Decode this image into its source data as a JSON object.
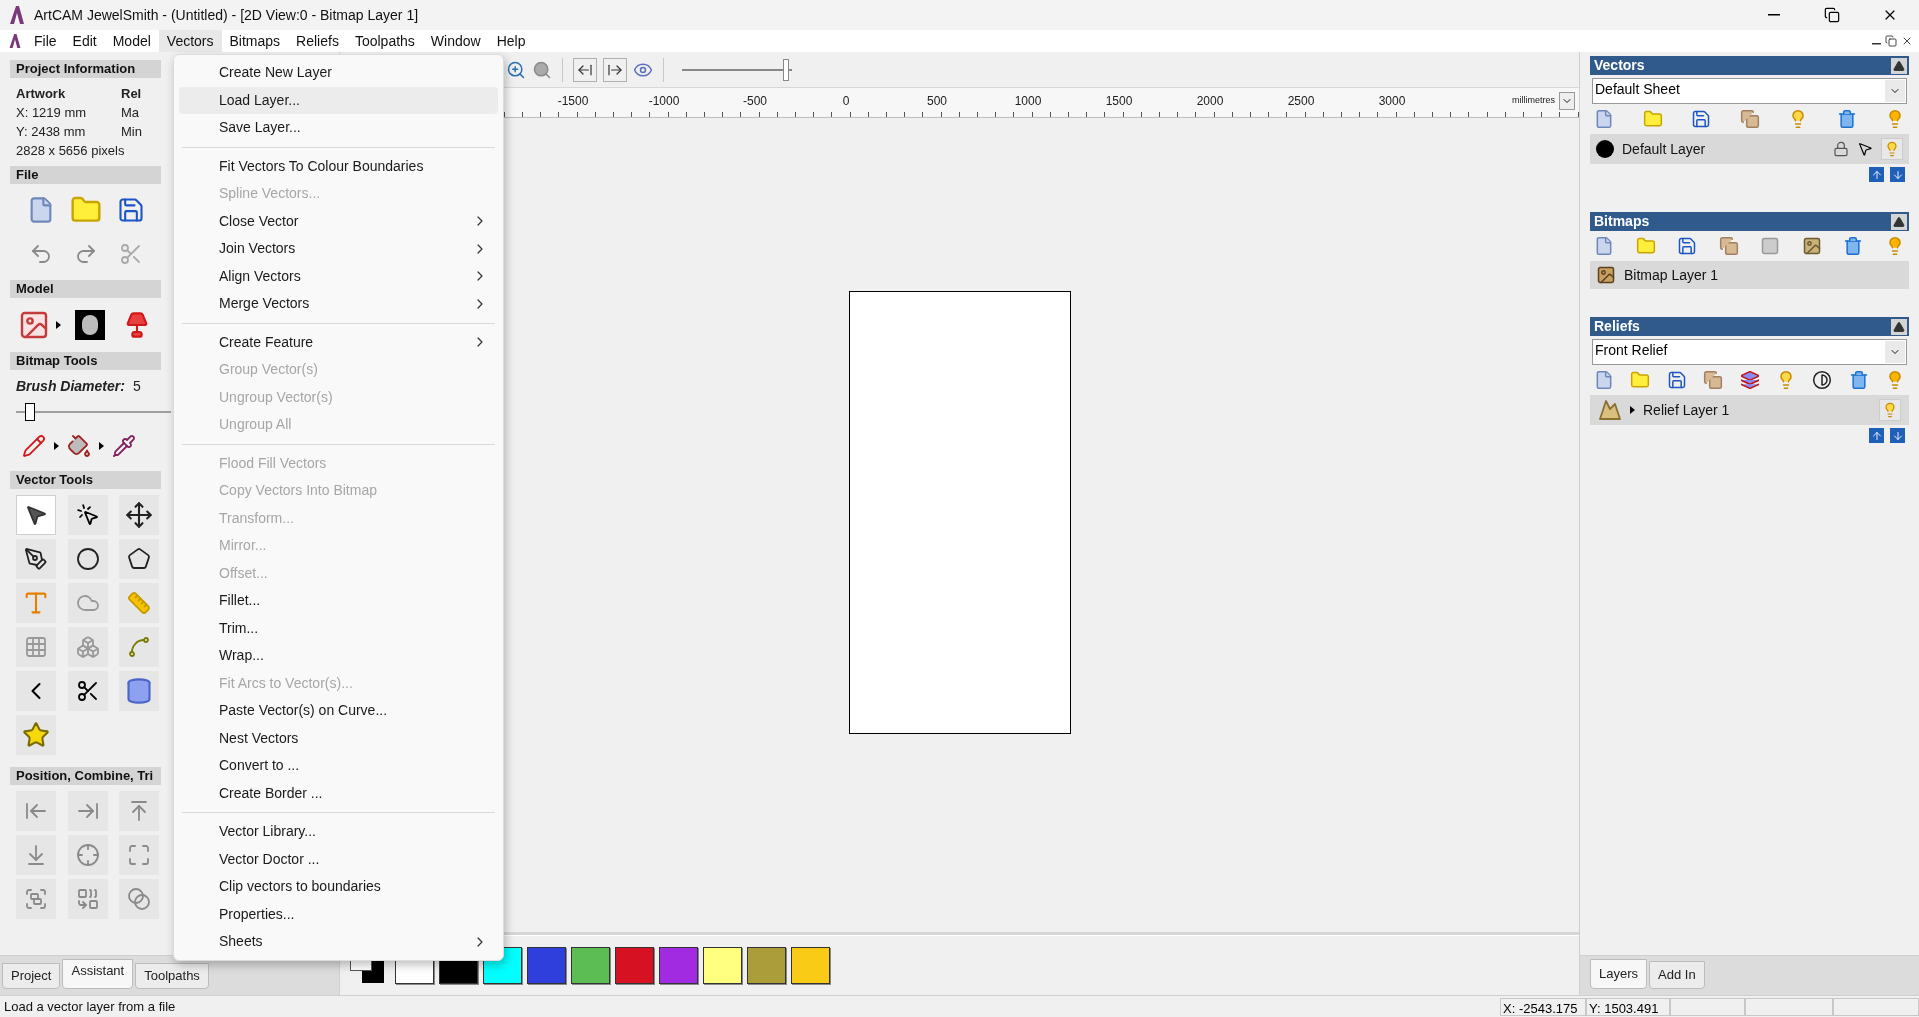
{
  "window": {
    "title": "ArtCAM JewelSmith - (Untitled) - [2D View:0 - Bitmap Layer 1]"
  },
  "menubar": [
    {
      "label": "File",
      "selected": false
    },
    {
      "label": "Edit",
      "selected": false
    },
    {
      "label": "Model",
      "selected": false
    },
    {
      "label": "Vectors",
      "selected": true
    },
    {
      "label": "Bitmaps",
      "selected": false
    },
    {
      "label": "Reliefs",
      "selected": false
    },
    {
      "label": "Toolpaths",
      "selected": false
    },
    {
      "label": "Window",
      "selected": false
    },
    {
      "label": "Help",
      "selected": false
    }
  ],
  "vectors_menu": {
    "groups": [
      [
        {
          "label": "Create New Layer",
          "disabled": false,
          "submenu": false,
          "selected": false
        },
        {
          "label": "Load Layer...",
          "disabled": false,
          "submenu": false,
          "selected": true
        },
        {
          "label": "Save Layer...",
          "disabled": false,
          "submenu": false,
          "selected": false
        }
      ],
      [
        {
          "label": "Fit Vectors To Colour Boundaries",
          "disabled": false,
          "submenu": false,
          "selected": false
        },
        {
          "label": "Spline Vectors...",
          "disabled": true,
          "submenu": false,
          "selected": false
        },
        {
          "label": "Close Vector",
          "disabled": false,
          "submenu": true,
          "selected": false
        },
        {
          "label": "Join Vectors",
          "disabled": false,
          "submenu": true,
          "selected": false
        },
        {
          "label": "Align Vectors",
          "disabled": false,
          "submenu": true,
          "selected": false
        },
        {
          "label": "Merge Vectors",
          "disabled": false,
          "submenu": true,
          "selected": false
        }
      ],
      [
        {
          "label": "Create Feature",
          "disabled": false,
          "submenu": true,
          "selected": false
        },
        {
          "label": "Group Vector(s)",
          "disabled": true,
          "submenu": false,
          "selected": false
        },
        {
          "label": "Ungroup Vector(s)",
          "disabled": true,
          "submenu": false,
          "selected": false
        },
        {
          "label": "Ungroup All",
          "disabled": true,
          "submenu": false,
          "selected": false
        }
      ],
      [
        {
          "label": "Flood Fill Vectors",
          "disabled": true,
          "submenu": false,
          "selected": false
        },
        {
          "label": "Copy Vectors Into Bitmap",
          "disabled": true,
          "submenu": false,
          "selected": false
        },
        {
          "label": "Transform...",
          "disabled": true,
          "submenu": false,
          "selected": false
        },
        {
          "label": "Mirror...",
          "disabled": true,
          "submenu": false,
          "selected": false
        },
        {
          "label": "Offset...",
          "disabled": true,
          "submenu": false,
          "selected": false
        },
        {
          "label": "Fillet...",
          "disabled": false,
          "submenu": false,
          "selected": false
        },
        {
          "label": "Trim...",
          "disabled": false,
          "submenu": false,
          "selected": false
        },
        {
          "label": "Wrap...",
          "disabled": false,
          "submenu": false,
          "selected": false
        },
        {
          "label": "Fit Arcs to Vector(s)...",
          "disabled": true,
          "submenu": false,
          "selected": false
        },
        {
          "label": "Paste Vector(s) on Curve...",
          "disabled": false,
          "submenu": false,
          "selected": false
        },
        {
          "label": "Nest Vectors",
          "disabled": false,
          "submenu": false,
          "selected": false
        },
        {
          "label": "Convert to ...",
          "disabled": false,
          "submenu": false,
          "selected": false
        },
        {
          "label": "Create Border ...",
          "disabled": false,
          "submenu": false,
          "selected": false
        }
      ],
      [
        {
          "label": "Vector Library...",
          "disabled": false,
          "submenu": false,
          "selected": false
        },
        {
          "label": "Vector Doctor ...",
          "disabled": false,
          "submenu": false,
          "selected": false
        },
        {
          "label": "Clip vectors to boundaries",
          "disabled": false,
          "submenu": false,
          "selected": false
        },
        {
          "label": "Properties...",
          "disabled": false,
          "submenu": false,
          "selected": false
        },
        {
          "label": "Sheets",
          "disabled": false,
          "submenu": true,
          "selected": false
        }
      ]
    ]
  },
  "left_panel": {
    "project_information": {
      "title": "Project Information",
      "artwork": {
        "heading": "Artwork",
        "lines": [
          "X: 1219 mm",
          "Y: 2438 mm",
          "2828 x 5656 pixels"
        ]
      },
      "relief": {
        "heading": "Rel",
        "lines": [
          "Ma",
          "Min"
        ]
      }
    },
    "file": {
      "title": "File"
    },
    "model": {
      "title": "Model"
    },
    "bitmap_tools": {
      "title": "Bitmap Tools",
      "brush_label": "Brush Diameter:",
      "brush_value": "5",
      "brush_slider": {
        "level": 0.06
      }
    },
    "vector_tools": {
      "title": "Vector Tools",
      "tools": [
        {
          "selected": true
        },
        {
          "selected": false
        },
        {
          "selected": false
        },
        {
          "selected": false
        },
        {
          "selected": false
        },
        {
          "selected": false
        },
        {
          "selected": false
        },
        {
          "selected": false
        },
        {
          "selected": false
        },
        {
          "selected": false
        },
        {
          "selected": false
        },
        {
          "selected": false
        },
        {
          "selected": false
        },
        {
          "selected": false
        },
        {
          "selected": false
        },
        {
          "selected": false
        }
      ]
    },
    "position_tools": {
      "title": "Position, Combine, Tri"
    },
    "tabs": [
      {
        "label": "Project",
        "selected": false
      },
      {
        "label": "Assistant",
        "selected": true
      },
      {
        "label": "Toolpaths",
        "selected": false
      }
    ]
  },
  "toolbar": {
    "zoom_slider": {
      "level": 0.97
    }
  },
  "ruler": {
    "labels": [
      "-1500",
      "-1000",
      "-500",
      "0",
      "500",
      "1000",
      "1500",
      "2000",
      "2500",
      "3000"
    ],
    "unit": "millimetres"
  },
  "palette": {
    "swatches": [
      {
        "color": "#ffffff"
      },
      {
        "color": "#000000"
      },
      {
        "color": "#00ffff"
      },
      {
        "color": "#2f3fdc"
      },
      {
        "color": "#5cbd55"
      },
      {
        "color": "#d61222"
      },
      {
        "color": "#a12be0"
      },
      {
        "color": "#ffff80"
      },
      {
        "color": "#ab9d3a"
      },
      {
        "color": "#f9cb16"
      }
    ]
  },
  "vectors_panel": {
    "title": "Vectors",
    "sheet": "Default Sheet",
    "layers": [
      {
        "name": "Default Layer",
        "color": "#000000"
      }
    ]
  },
  "bitmaps_panel": {
    "title": "Bitmaps",
    "layers": [
      {
        "name": "Bitmap Layer 1"
      }
    ]
  },
  "reliefs_panel": {
    "title": "Reliefs",
    "sheet": "Front Relief",
    "layers": [
      {
        "name": "Relief Layer 1"
      }
    ]
  },
  "right_tabs": [
    {
      "label": "Layers",
      "selected": true
    },
    {
      "label": "Add In",
      "selected": false
    }
  ],
  "status_bar": {
    "message": "Load a vector layer from a file",
    "x": "X: -2543.175",
    "y": "Y: 1503.491"
  }
}
